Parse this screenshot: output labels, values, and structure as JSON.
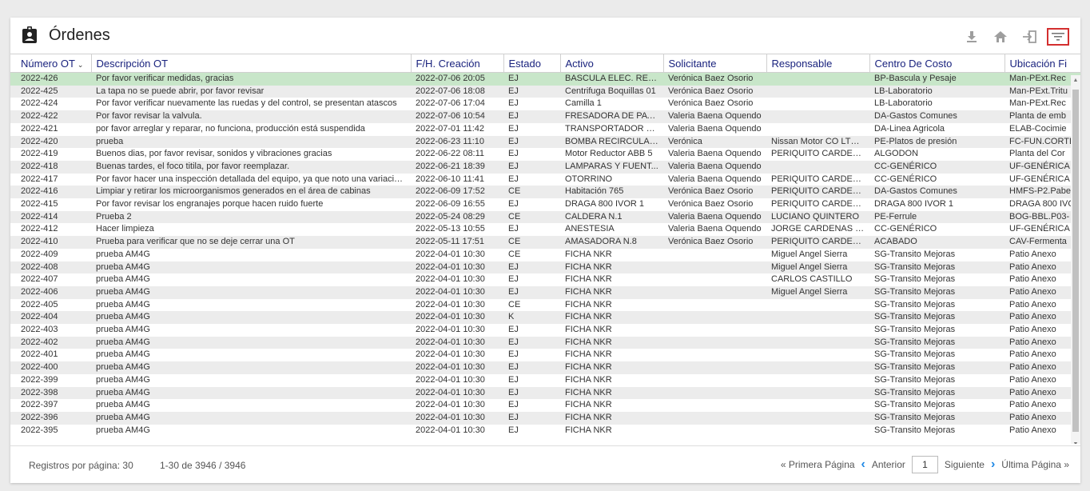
{
  "header": {
    "title": "Órdenes"
  },
  "toolbar": {
    "icons": [
      "download-icon",
      "home-icon",
      "logout-icon",
      "filter-icon"
    ]
  },
  "columns": [
    "Número OT",
    "Descripción OT",
    "F/H. Creación",
    "Estado",
    "Activo",
    "Solicitante",
    "Responsable",
    "Centro De Costo",
    "Ubicación Fi"
  ],
  "rows": [
    [
      "2022-426",
      "Por favor verificar medidas, gracias",
      "2022-07-06 20:05",
      "EJ",
      "BASCULA ELEC. REC...",
      "Verónica Baez Osorio",
      "",
      "BP-Bascula y Pesaje",
      "Man-PExt.Rec"
    ],
    [
      "2022-425",
      "La tapa no se puede abrir, por favor revisar",
      "2022-07-06 18:08",
      "EJ",
      "Centrifuga Boquillas 01",
      "Verónica Baez Osorio",
      "",
      "LB-Laboratorio",
      "Man-PExt.Tritu"
    ],
    [
      "2022-424",
      "Por favor verificar nuevamente las ruedas y del control, se presentan atascos",
      "2022-07-06 17:04",
      "EJ",
      "Camilla 1",
      "Verónica Baez Osorio",
      "",
      "LB-Laboratorio",
      "Man-PExt.Rec"
    ],
    [
      "2022-422",
      "Por favor revisar la valvula.",
      "2022-07-06 10:54",
      "EJ",
      "FRESADORA DE PAVI...",
      "Valeria Baena Oquendo",
      "",
      "DA-Gastos Comunes",
      "Planta de emb"
    ],
    [
      "2022-421",
      "por favor arreglar y reparar, no funciona, producción está suspendida",
      "2022-07-01 11:42",
      "EJ",
      "TRANSPORTADOR 1 ...",
      "Valeria Baena Oquendo",
      "",
      "DA-Linea Agricola",
      "ELAB-Cocimie"
    ],
    [
      "2022-420",
      "prueba",
      "2022-06-23 11:10",
      "EJ",
      "BOMBA RECIRCULAC...",
      "Verónica",
      "Nissan Motor CO LTDA.",
      "PE-Platos de presión",
      "FC-FUN.CORTE"
    ],
    [
      "2022-419",
      "Buenos dias, por favor revisar, sonidos y vibraciones gracias",
      "2022-06-22 08:11",
      "EJ",
      "Motor Reductor ABB 5",
      "Valeria Baena Oquendo",
      "PERIQUITO CARDENAS",
      "ALGODON",
      "Planta del Cor"
    ],
    [
      "2022-418",
      "Buenas tardes, el foco titila, por favor reemplazar.",
      "2022-06-21 18:39",
      "EJ",
      "LAMPARAS Y FUENT...",
      "Valeria Baena Oquendo",
      "",
      "CC-GENÉRICO",
      "UF-GENÉRICA"
    ],
    [
      "2022-417",
      "Por favor hacer una inspección detallada del equipo, ya que noto una variación en su funcionamiento",
      "2022-06-10 11:41",
      "EJ",
      "OTORRINO",
      "Valeria Baena Oquendo",
      "PERIQUITO CARDENAS",
      "CC-GENÉRICO",
      "UF-GENÉRICA"
    ],
    [
      "2022-416",
      "Limpiar y retirar los microorganismos generados en el área de cabinas",
      "2022-06-09 17:52",
      "CE",
      "Habitación 765",
      "Verónica Baez Osorio",
      "PERIQUITO CARDENAS",
      "DA-Gastos Comunes",
      "HMFS-P2.Pabe"
    ],
    [
      "2022-415",
      "Por favor revisar los engranajes porque hacen ruido fuerte",
      "2022-06-09 16:55",
      "EJ",
      "DRAGA 800 IVOR 1",
      "Verónica Baez Osorio",
      "PERIQUITO CARDENAS",
      "DRAGA 800 IVOR 1",
      "DRAGA 800 IVO"
    ],
    [
      "2022-414",
      "Prueba 2",
      "2022-05-24 08:29",
      "CE",
      "CALDERA N.1",
      "Valeria Baena Oquendo",
      "LUCIANO QUINTERO",
      "PE-Ferrule",
      "BOG-BBL.P03-"
    ],
    [
      "2022-412",
      "Hacer limpieza",
      "2022-05-13 10:55",
      "EJ",
      "ANESTESIA",
      "Valeria Baena Oquendo",
      "JORGE CARDENAS G...",
      "CC-GENÉRICO",
      "UF-GENÉRICA"
    ],
    [
      "2022-410",
      "Prueba para verificar que no se deje cerrar una OT",
      "2022-05-11 17:51",
      "CE",
      "AMASADORA N.8",
      "Verónica Baez Osorio",
      "PERIQUITO CARDENAS",
      "ACABADO",
      "CAV-Fermenta"
    ],
    [
      "2022-409",
      "prueba AM4G",
      "2022-04-01 10:30",
      "CE",
      "FICHA NKR",
      "",
      "Miguel Angel Sierra",
      "SG-Transito Mejoras",
      "Patio Anexo"
    ],
    [
      "2022-408",
      "prueba AM4G",
      "2022-04-01 10:30",
      "EJ",
      "FICHA NKR",
      "",
      "Miguel Angel Sierra",
      "SG-Transito Mejoras",
      "Patio Anexo"
    ],
    [
      "2022-407",
      "prueba AM4G",
      "2022-04-01 10:30",
      "EJ",
      "FICHA NKR",
      "",
      "CARLOS CASTILLO",
      "SG-Transito Mejoras",
      "Patio Anexo"
    ],
    [
      "2022-406",
      "prueba AM4G",
      "2022-04-01 10:30",
      "EJ",
      "FICHA NKR",
      "",
      "Miguel Angel Sierra",
      "SG-Transito Mejoras",
      "Patio Anexo"
    ],
    [
      "2022-405",
      "prueba AM4G",
      "2022-04-01 10:30",
      "CE",
      "FICHA NKR",
      "",
      "",
      "SG-Transito Mejoras",
      "Patio Anexo"
    ],
    [
      "2022-404",
      "prueba AM4G",
      "2022-04-01 10:30",
      "K",
      "FICHA NKR",
      "",
      "",
      "SG-Transito Mejoras",
      "Patio Anexo"
    ],
    [
      "2022-403",
      "prueba AM4G",
      "2022-04-01 10:30",
      "EJ",
      "FICHA NKR",
      "",
      "",
      "SG-Transito Mejoras",
      "Patio Anexo"
    ],
    [
      "2022-402",
      "prueba AM4G",
      "2022-04-01 10:30",
      "EJ",
      "FICHA NKR",
      "",
      "",
      "SG-Transito Mejoras",
      "Patio Anexo"
    ],
    [
      "2022-401",
      "prueba AM4G",
      "2022-04-01 10:30",
      "EJ",
      "FICHA NKR",
      "",
      "",
      "SG-Transito Mejoras",
      "Patio Anexo"
    ],
    [
      "2022-400",
      "prueba AM4G",
      "2022-04-01 10:30",
      "EJ",
      "FICHA NKR",
      "",
      "",
      "SG-Transito Mejoras",
      "Patio Anexo"
    ],
    [
      "2022-399",
      "prueba AM4G",
      "2022-04-01 10:30",
      "EJ",
      "FICHA NKR",
      "",
      "",
      "SG-Transito Mejoras",
      "Patio Anexo"
    ],
    [
      "2022-398",
      "prueba AM4G",
      "2022-04-01 10:30",
      "EJ",
      "FICHA NKR",
      "",
      "",
      "SG-Transito Mejoras",
      "Patio Anexo"
    ],
    [
      "2022-397",
      "prueba AM4G",
      "2022-04-01 10:30",
      "EJ",
      "FICHA NKR",
      "",
      "",
      "SG-Transito Mejoras",
      "Patio Anexo"
    ],
    [
      "2022-396",
      "prueba AM4G",
      "2022-04-01 10:30",
      "EJ",
      "FICHA NKR",
      "",
      "",
      "SG-Transito Mejoras",
      "Patio Anexo"
    ],
    [
      "2022-395",
      "prueba AM4G",
      "2022-04-01 10:30",
      "EJ",
      "FICHA NKR",
      "",
      "",
      "SG-Transito Mejoras",
      "Patio Anexo"
    ]
  ],
  "footer": {
    "rows_per_page": "Registros por página: 30",
    "range": "1-30 de 3946 / 3946",
    "first": "« Primera Página",
    "prev": "Anterior",
    "page": "1",
    "next": "Siguiente",
    "last": "Última Página »"
  },
  "colors": {
    "accent": "#1e88e5",
    "header_text": "#1a237e",
    "selected_row": "#c8e6c9",
    "filter_border": "#d32f2f"
  }
}
